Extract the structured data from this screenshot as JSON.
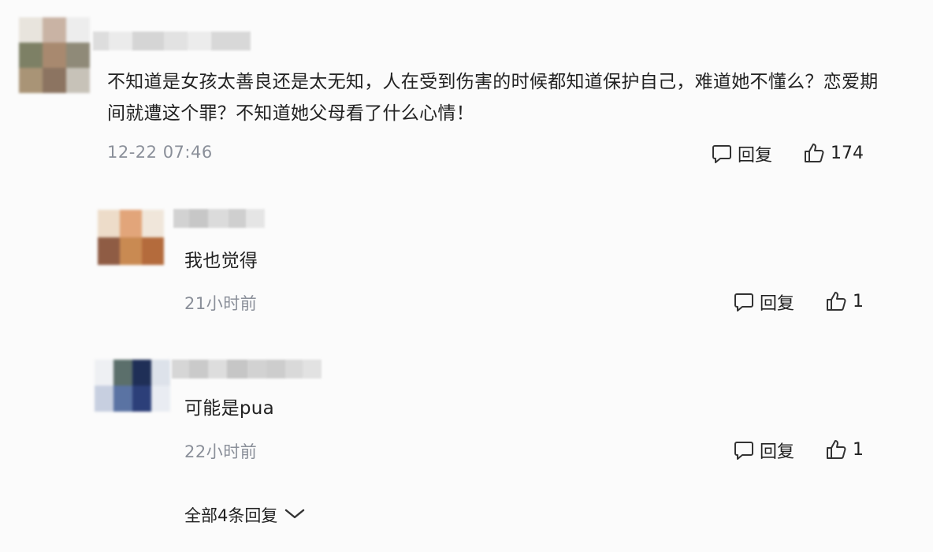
{
  "comments": [
    {
      "text": "不知道是女孩太善良还是太无知，人在受到伤害的时候都知道保护自己，难道她不懂么？恋爱期间就遭这个罪？不知道她父母看了什么心情！",
      "time": "12-22 07:46",
      "reply_label": "回复",
      "like_count": "174"
    }
  ],
  "replies": [
    {
      "text": "我也觉得",
      "time": "21小时前",
      "reply_label": "回复",
      "like_count": "1"
    },
    {
      "text": "可能是pua",
      "time": "22小时前",
      "reply_label": "回复",
      "like_count": "1"
    }
  ],
  "more_replies_label": "全部4条回复",
  "colors": {
    "timestamp": "#8a8f99",
    "text": "#222222",
    "background": "#fbfbfb"
  },
  "icons": {
    "reply": "speech-bubble-icon",
    "like": "thumbs-up-icon",
    "expand": "chevron-down-icon"
  }
}
